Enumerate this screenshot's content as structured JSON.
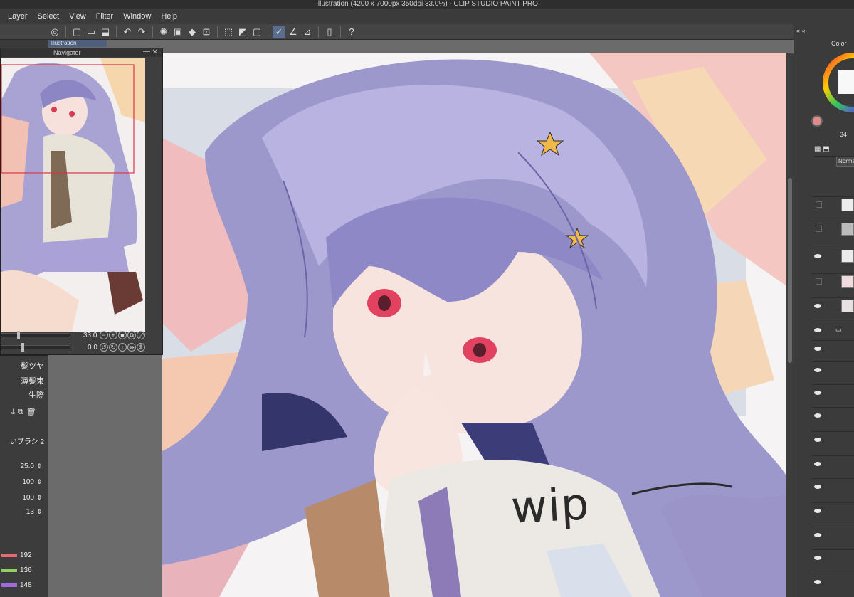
{
  "window": {
    "title": "Illustration (4200 x 7000px 350dpi 33.0%)  - CLIP STUDIO PAINT PRO"
  },
  "menu": [
    "Layer",
    "Select",
    "View",
    "Filter",
    "Window",
    "Help"
  ],
  "document_tab": {
    "label": "Illustration"
  },
  "navigator": {
    "title": "Navigator",
    "zoom": "33.0",
    "rotation": "0.0"
  },
  "sub_tools": [
    {
      "label": "髪ツヤ"
    },
    {
      "label": "薄髪束"
    },
    {
      "label": "生際"
    }
  ],
  "brush": {
    "name": "いブラシ 2",
    "size": "25.0",
    "opacity": "100",
    "density": "100",
    "extra": "13"
  },
  "color_values": [
    {
      "value": "192",
      "color": "#e26b74"
    },
    {
      "value": "136",
      "color": "#8ecf5e"
    },
    {
      "value": "148",
      "color": "#a06ad8"
    }
  ],
  "right_panel": {
    "color_tab": "Color",
    "blend_mode": "Normal",
    "size_readout": "34"
  },
  "canvas_text": "wip"
}
